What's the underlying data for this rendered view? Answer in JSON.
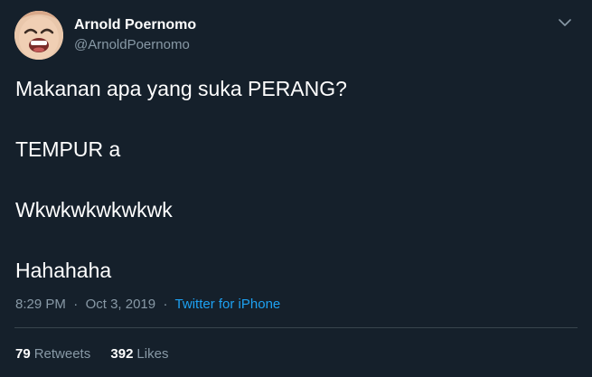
{
  "tweet": {
    "author": {
      "display_name": "Arnold Poernomo",
      "handle": "@ArnoldPoernomo"
    },
    "text_lines": [
      "Makanan apa yang suka PERANG?",
      "TEMPUR a",
      "Wkwkwkwkwkwk",
      "Hahahaha"
    ],
    "time": "8:29 PM",
    "separator": "·",
    "date": "Oct 3, 2019",
    "source": "Twitter for iPhone",
    "retweets": {
      "count": "79",
      "label": "Retweets"
    },
    "likes": {
      "count": "392",
      "label": "Likes"
    },
    "icons": {
      "menu": "chevron-down-icon",
      "avatar": "avatar"
    }
  },
  "colors": {
    "background": "#15202b",
    "text_primary": "#ffffff",
    "text_secondary": "#8899a6",
    "link": "#1da1f2",
    "divider": "#38444d"
  }
}
